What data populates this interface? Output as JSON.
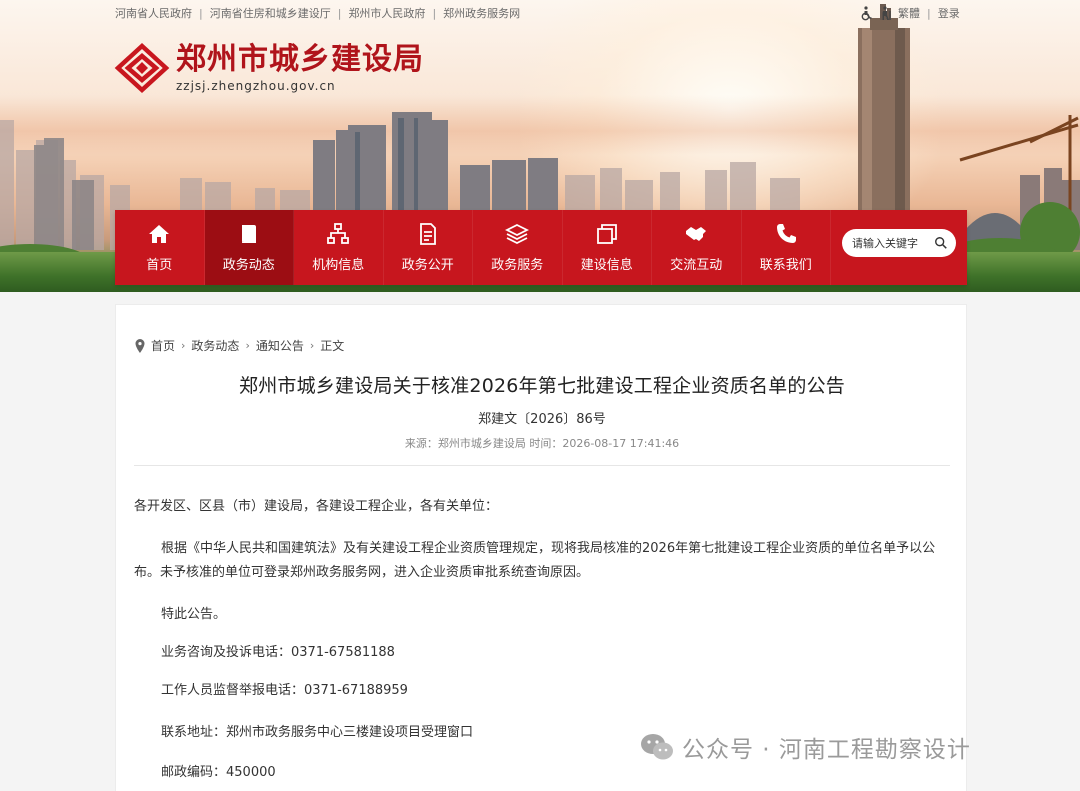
{
  "top_links": [
    "河南省人民政府",
    "河南省住房和城乡建设厅",
    "郑州市人民政府",
    "郑州政务服务网"
  ],
  "top_right": {
    "traditional": "繁體",
    "login": "登录"
  },
  "logo": {
    "title": "郑州市城乡建设局",
    "url": "zzjsj.zhengzhou.gov.cn"
  },
  "nav": [
    {
      "label": "首页",
      "icon": "home-icon"
    },
    {
      "label": "政务动态",
      "icon": "book-icon",
      "active": true
    },
    {
      "label": "机构信息",
      "icon": "org-chart-icon"
    },
    {
      "label": "政务公开",
      "icon": "document-icon"
    },
    {
      "label": "政务服务",
      "icon": "layers-icon"
    },
    {
      "label": "建设信息",
      "icon": "files-icon"
    },
    {
      "label": "交流互动",
      "icon": "handshake-icon"
    },
    {
      "label": "联系我们",
      "icon": "phone-icon"
    }
  ],
  "search": {
    "placeholder": "请输入关键字"
  },
  "breadcrumb": [
    "首页",
    "政务动态",
    "通知公告",
    "正文"
  ],
  "article": {
    "title": "郑州市城乡建设局关于核准2026年第七批建设工程企业资质名单的公告",
    "doc_number": "郑建文〔2026〕86号",
    "meta": "来源：郑州市城乡建设局  时间：2026-08-17 17:41:46",
    "salutation": "各开发区、区县（市）建设局，各建设工程企业，各有关单位：",
    "main_paragraph": "根据《中华人民共和国建筑法》及有关建设工程企业资质管理规定，现将我局核准的2026年第七批建设工程企业资质的单位名单予以公布。未予核准的单位可登录郑州政务服务网，进入企业资质审批系统查询原因。",
    "notice": "特此公告。",
    "consult_phone": "业务咨询及投诉电话：0371-67581188",
    "report_phone": "工作人员监督举报电话：0371-67188959",
    "address": "联系地址：郑州市政务服务中心三楼建设项目受理窗口",
    "postcode": "邮政编码：450000"
  },
  "watermark": "公众号 · 河南工程勘察设计",
  "colors": {
    "nav_red": "#c7161e",
    "nav_active": "#9c0d13",
    "brand_red": "#b0141b"
  }
}
